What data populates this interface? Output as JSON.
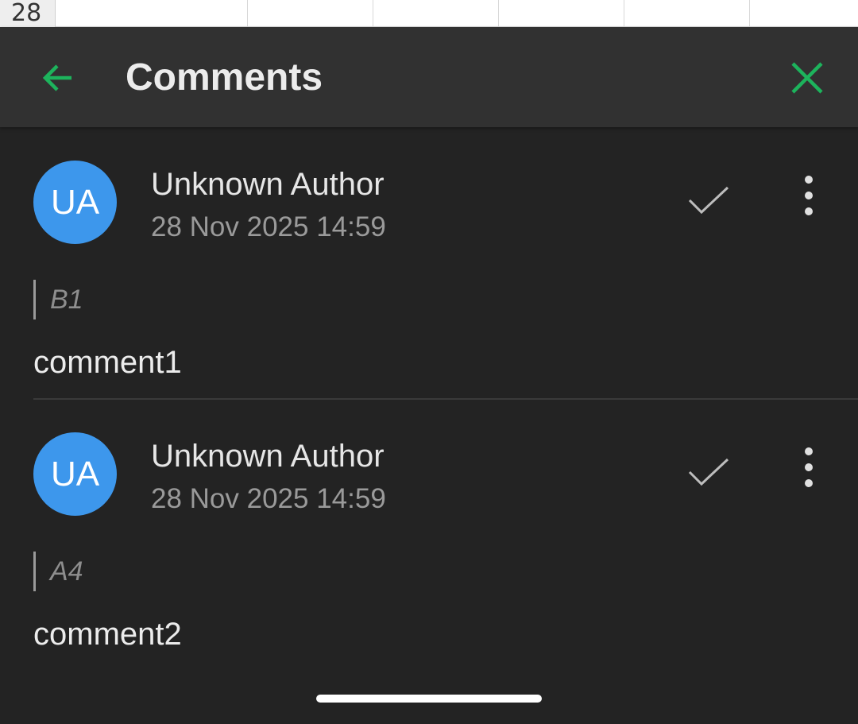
{
  "sheet": {
    "row_number": "28"
  },
  "header": {
    "title": "Comments",
    "back_icon": "arrow-left-icon",
    "close_icon": "close-icon",
    "accent_color": "#1db35c"
  },
  "comments": [
    {
      "avatar_initials": "UA",
      "author": "Unknown Author",
      "date": "28 Nov 2025 14:59",
      "cell_ref": "B1",
      "text": "comment1"
    },
    {
      "avatar_initials": "UA",
      "author": "Unknown Author",
      "date": "28 Nov 2025 14:59",
      "cell_ref": "A4",
      "text": "comment2"
    }
  ],
  "colors": {
    "background": "#232323",
    "header_bg": "#313131",
    "avatar_bg": "#3d97ec"
  }
}
